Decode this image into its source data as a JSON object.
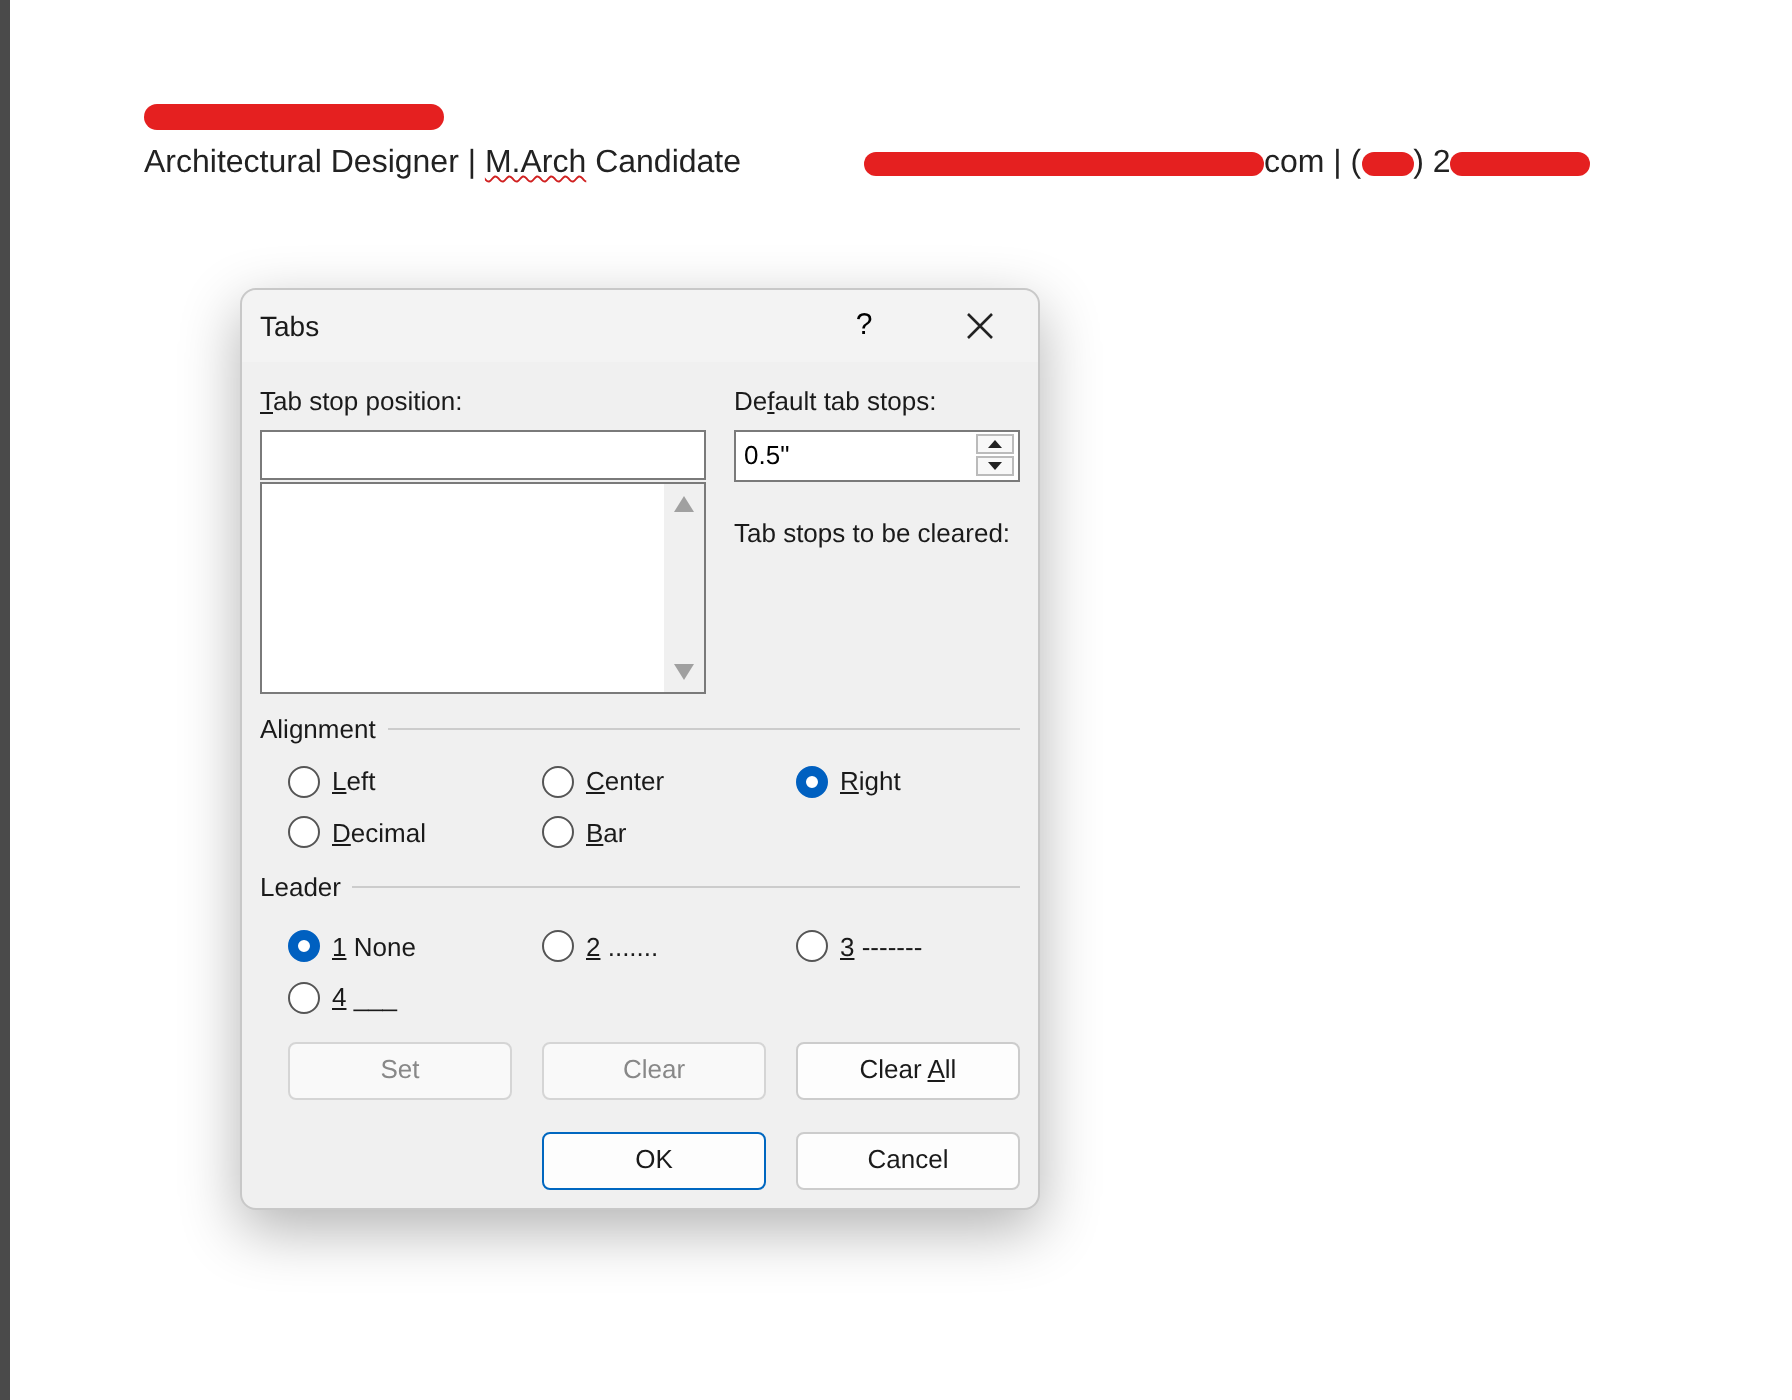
{
  "document": {
    "subtitle": [
      {
        "text": "Architectural Designer | ",
        "misspelled": false
      },
      {
        "text": "M.Arch",
        "misspelled": true
      },
      {
        "text": " Candidate",
        "misspelled": false
      }
    ],
    "contact": [
      "com | (",
      ") 2"
    ]
  },
  "dialog": {
    "title": "Tabs",
    "help": "?",
    "tab_stop_position": {
      "label": {
        "key": "T",
        "post": "ab stop position:"
      }
    },
    "default_tab_stops": {
      "label": {
        "pre": "De",
        "key": "f",
        "post": "ault tab stops:"
      },
      "value": "0.5\""
    },
    "cleared_label": "Tab stops to be cleared:",
    "alignment": {
      "title": "Alignment",
      "options": [
        {
          "label": {
            "key": "L",
            "post": "eft"
          },
          "selected": false
        },
        {
          "label": {
            "key": "C",
            "post": "enter"
          },
          "selected": false
        },
        {
          "label": {
            "key": "R",
            "post": "ight"
          },
          "selected": true
        },
        {
          "label": {
            "key": "D",
            "post": "ecimal"
          },
          "selected": false
        },
        {
          "label": {
            "key": "B",
            "post": "ar"
          },
          "selected": false
        }
      ]
    },
    "leader": {
      "title": "Leader",
      "options": [
        {
          "label": {
            "key": "1",
            "post": " None"
          },
          "selected": true
        },
        {
          "label": {
            "key": "2",
            "post": " ......."
          },
          "selected": false
        },
        {
          "label": {
            "key": "3",
            "post": " -------"
          },
          "selected": false
        },
        {
          "label": {
            "key": "4",
            "post": " ___"
          },
          "selected": false
        }
      ]
    },
    "action_buttons": [
      {
        "label": {
          "pre": "Set"
        },
        "disabled": true
      },
      {
        "label": {
          "pre": "Clear"
        },
        "disabled": true
      },
      {
        "label": {
          "pre": "Clear ",
          "key": "A",
          "post": "ll"
        },
        "disabled": false
      }
    ],
    "footer_buttons": [
      {
        "label": {
          "pre": "OK"
        },
        "default": true
      },
      {
        "label": {
          "pre": "Cancel"
        },
        "default": false
      }
    ]
  }
}
